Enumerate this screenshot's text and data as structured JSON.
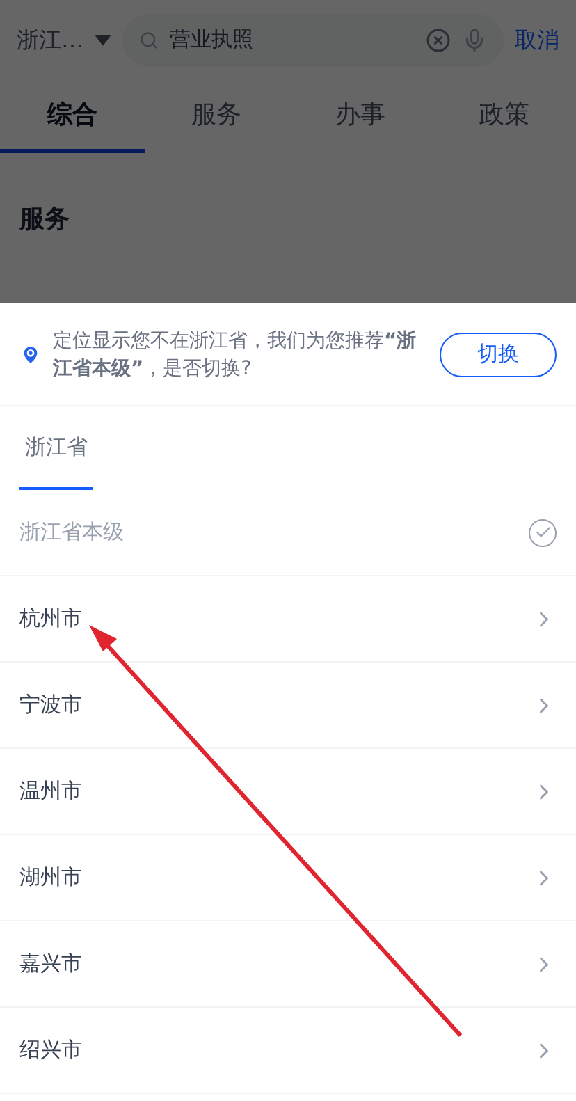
{
  "header": {
    "location": "浙江…",
    "search": {
      "value": "营业执照"
    },
    "cancel": "取消"
  },
  "tabs": [
    {
      "label": "综合",
      "selected": true
    },
    {
      "label": "服务",
      "selected": false
    },
    {
      "label": "办事",
      "selected": false
    },
    {
      "label": "政策",
      "selected": false
    }
  ],
  "section_title": "服务",
  "sheet": {
    "notice": "定位显示您不在浙江省，我们为您推荐**“浙江省本级”**，是否切换?",
    "switch_button": "切换",
    "region_tabs": [
      {
        "label": "浙江省",
        "selected": true
      }
    ],
    "items": [
      {
        "label": "浙江省本级",
        "selected": true
      },
      {
        "label": "杭州市",
        "selected": false
      },
      {
        "label": "宁波市",
        "selected": false
      },
      {
        "label": "温州市",
        "selected": false
      },
      {
        "label": "湖州市",
        "selected": false
      },
      {
        "label": "嘉兴市",
        "selected": false
      },
      {
        "label": "绍兴市",
        "selected": false
      }
    ]
  }
}
